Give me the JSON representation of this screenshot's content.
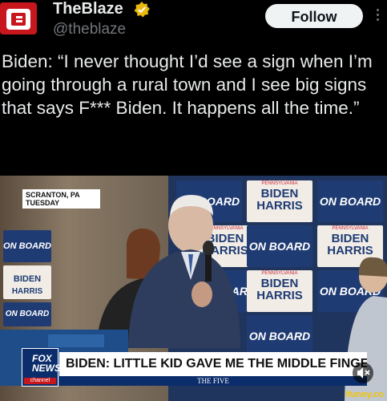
{
  "account": {
    "name": "TheBlaze",
    "handle": "@theblaze",
    "verified": true,
    "avatar_color": "#c8161d"
  },
  "actions": {
    "follow_label": "Follow",
    "more_icon": "more-vertical-icon"
  },
  "tweet": {
    "text": "Biden: “I never thought I’d see a sign when I’m going through a rural town and I see big signs that says F*** Biden. It happens all the time.”"
  },
  "video": {
    "location_label_line1": "SCRANTON, PA",
    "location_label_line2": "TUESDAY",
    "chyron": "BIDEN: LITTLE KID GAVE ME THE MIDDLE FINGER",
    "show_name": "THE FIVE",
    "network_line1": "FOX",
    "network_line2": "NEWS",
    "network_line3": "channel",
    "sign_biden": "BIDEN",
    "sign_harris": "HARRIS",
    "sign_onboard": "ON BOARD",
    "mute_icon": "speaker-muted-icon"
  },
  "watermark": "ifunny.co"
}
